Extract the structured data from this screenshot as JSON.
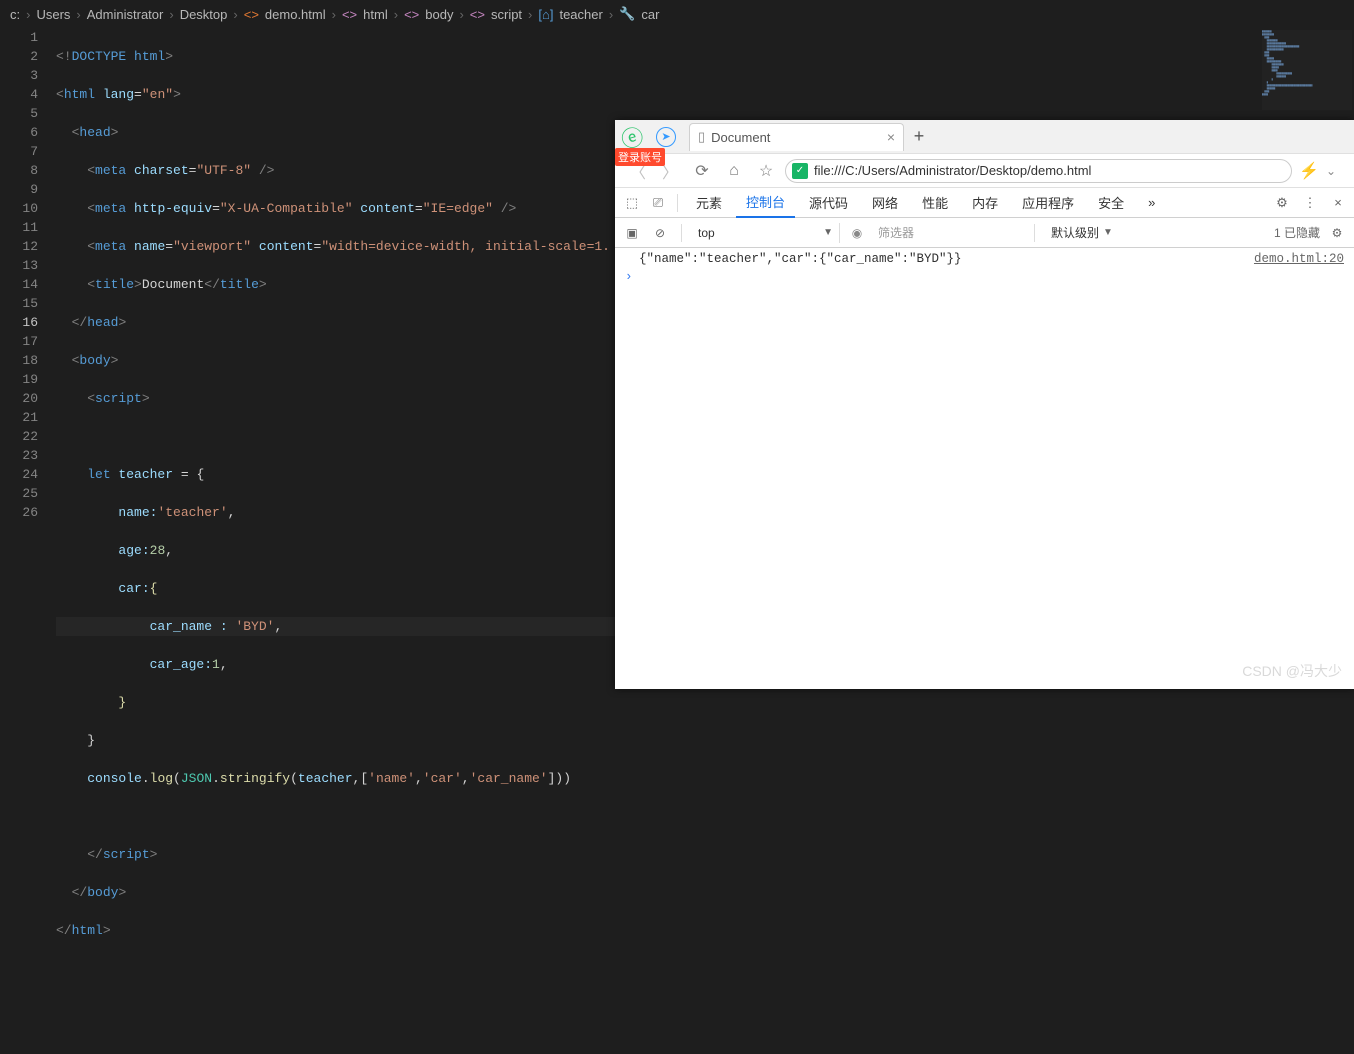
{
  "breadcrumb": {
    "items": [
      "c:",
      "Users",
      "Administrator",
      "Desktop",
      "demo.html",
      "html",
      "body",
      "script",
      "teacher",
      "car"
    ],
    "icon_file": "<>",
    "icon_tag": "<>",
    "icon_brace": "{}",
    "icon_wrench": "🔧"
  },
  "lines": {
    "count": 26,
    "active": 16
  },
  "code": {
    "l1a": "<!",
    "l1b": "DOCTYPE",
    "l1c": " html",
    "l1d": ">",
    "l2a": "<",
    "l2b": "html ",
    "l2c": "lang",
    "l2d": "=",
    "l2e": "\"en\"",
    "l2f": ">",
    "l3a": "<",
    "l3b": "head",
    "l3c": ">",
    "l4a": "<",
    "l4b": "meta ",
    "l4c": "charset",
    "l4d": "=",
    "l4e": "\"UTF-8\"",
    "l4f": " />",
    "l5a": "<",
    "l5b": "meta ",
    "l5c": "http-equiv",
    "l5d": "=",
    "l5e": "\"X-UA-Compatible\"",
    "l5f": " content",
    "l5g": "=",
    "l5h": "\"IE=edge\"",
    "l5i": " />",
    "l6a": "<",
    "l6b": "meta ",
    "l6c": "name",
    "l6d": "=",
    "l6e": "\"viewport\"",
    "l6f": " content",
    "l6g": "=",
    "l6h": "\"width=device-width, initial-scale=1.",
    "l7a": "<",
    "l7b": "title",
    "l7c": ">",
    "l7d": "Document",
    "l7e": "</",
    "l7f": "title",
    "l7g": ">",
    "l8a": "</",
    "l8b": "head",
    "l8c": ">",
    "l9a": "<",
    "l9b": "body",
    "l9c": ">",
    "l10a": "<",
    "l10b": "script",
    "l10c": ">",
    "l12a": "let",
    "l12b": " teacher ",
    "l12c": "= {",
    "l13a": "name:",
    "l13b": "'teacher'",
    "l13c": ",",
    "l14a": "age:",
    "l14b": "28",
    "l14c": ",",
    "l15a": "car:",
    "l15b": "{",
    "l16a": "car_name : ",
    "l16b": "'BYD'",
    "l16c": ",",
    "l17a": "car_age:",
    "l17b": "1",
    "l17c": ",",
    "l18a": "}",
    "l19a": "}",
    "l20a": "console",
    "l20b": ".",
    "l20c": "log",
    "l20d": "(",
    "l20e": "JSON",
    "l20f": ".",
    "l20g": "stringify",
    "l20h": "(",
    "l20i": "teacher",
    "l20j": ",[",
    "l20k": "'name'",
    "l20l": ",",
    "l20m": "'car'",
    "l20n": ",",
    "l20o": "'car_name'",
    "l20p": "]))",
    "l22a": "</",
    "l22b": "script",
    "l22c": ">",
    "l23a": "</",
    "l23b": "body",
    "l23c": ">",
    "l24a": "</",
    "l24b": "html",
    "l24c": ">"
  },
  "browser": {
    "login_badge": "登录账号",
    "tab_title": "Document",
    "url": "file:///C:/Users/Administrator/Desktop/demo.html",
    "devtools": {
      "tabs": [
        "元素",
        "控制台",
        "源代码",
        "网络",
        "性能",
        "内存",
        "应用程序",
        "安全"
      ],
      "more": "»",
      "active_index": 1
    },
    "filter": {
      "context": "top",
      "placeholder": "筛选器",
      "level": "默认级别",
      "hidden": "1 已隐藏"
    },
    "console": {
      "output": "{\"name\":\"teacher\",\"car\":{\"car_name\":\"BYD\"}}",
      "location": "demo.html:20",
      "prompt": "›"
    }
  },
  "watermark": "CSDN @冯大少"
}
